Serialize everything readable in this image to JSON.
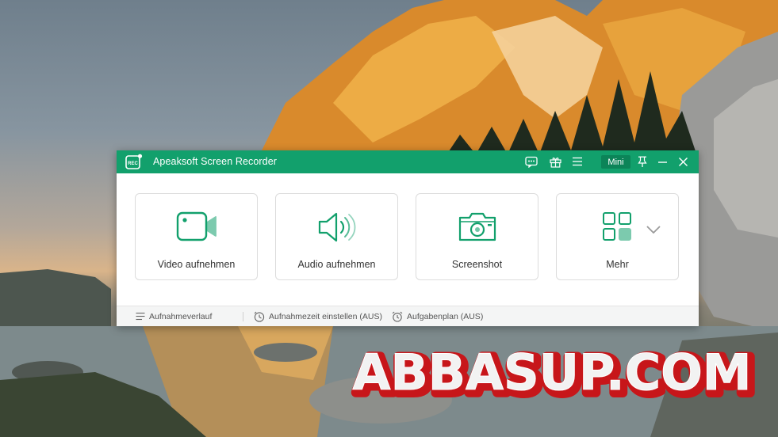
{
  "app": {
    "title": "Apeaksoft Screen Recorder",
    "logo_text": "REC",
    "accent_color": "#12a06c",
    "mini_label": "Mini"
  },
  "titlebar_icons": [
    "feedback-icon",
    "gift-icon",
    "menu-icon",
    "pin-icon",
    "minimize-icon",
    "close-icon"
  ],
  "cards": [
    {
      "label": "Video aufnehmen",
      "icon": "video-camera-icon"
    },
    {
      "label": "Audio aufnehmen",
      "icon": "speaker-icon"
    },
    {
      "label": "Screenshot",
      "icon": "camera-icon"
    },
    {
      "label": "Mehr",
      "icon": "grid-icon"
    }
  ],
  "footer": {
    "history_label": "Aufnahmeverlauf",
    "set_time_label": "Aufnahmezeit einstellen (AUS)",
    "schedule_label": "Aufgabenplan (AUS)"
  },
  "watermark": {
    "text": "ABBASUP.COM"
  }
}
